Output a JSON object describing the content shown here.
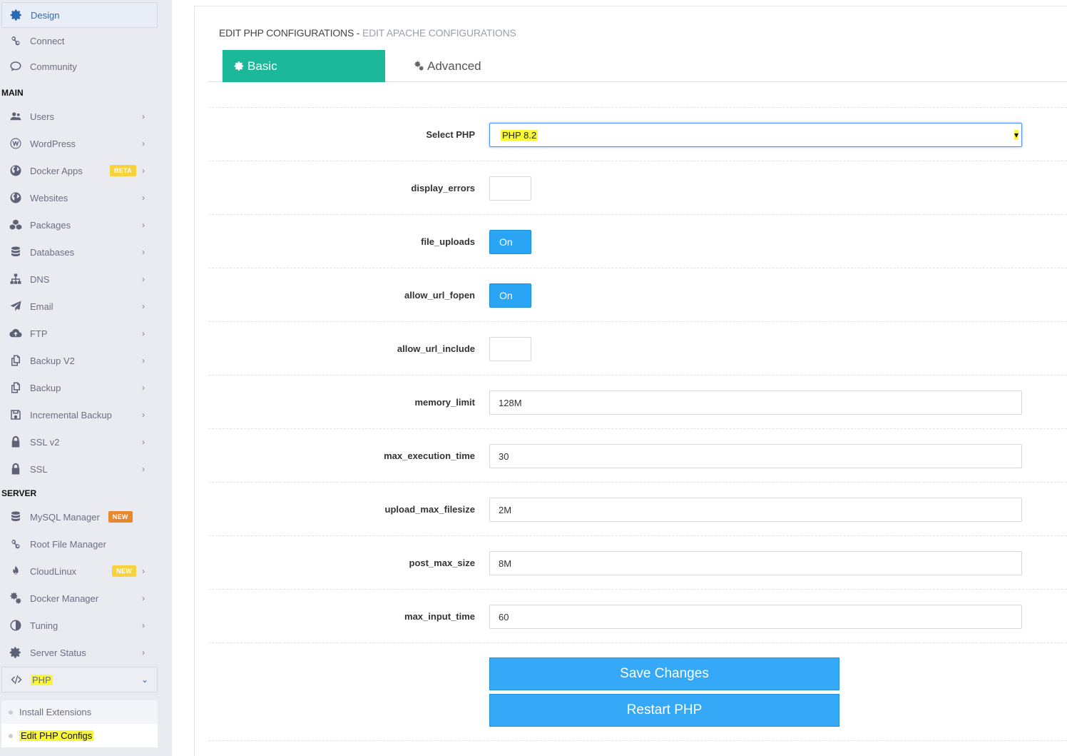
{
  "sidebar": {
    "top_items": [
      {
        "label": "Design",
        "icon": "gear-icon"
      },
      {
        "label": "Connect",
        "icon": "link-icon"
      },
      {
        "label": "Community",
        "icon": "chat-icon"
      }
    ],
    "sections": {
      "main": "MAIN",
      "server": "SERVER"
    },
    "main_items": [
      {
        "label": "Users",
        "icon": "users-icon"
      },
      {
        "label": "WordPress",
        "icon": "wordpress-icon"
      },
      {
        "label": "Docker Apps",
        "icon": "globe-icon",
        "badge": "BETA"
      },
      {
        "label": "Websites",
        "icon": "globe-icon"
      },
      {
        "label": "Packages",
        "icon": "cubes-icon"
      },
      {
        "label": "Databases",
        "icon": "database-icon"
      },
      {
        "label": "DNS",
        "icon": "sitemap-icon"
      },
      {
        "label": "Email",
        "icon": "paper-plane-icon"
      },
      {
        "label": "FTP",
        "icon": "cloud-upload-icon"
      },
      {
        "label": "Backup V2",
        "icon": "copy-icon"
      },
      {
        "label": "Backup",
        "icon": "copy-icon"
      },
      {
        "label": "Incremental Backup",
        "icon": "save-icon"
      },
      {
        "label": "SSL v2",
        "icon": "lock-icon"
      },
      {
        "label": "SSL",
        "icon": "lock-icon"
      }
    ],
    "server_items": [
      {
        "label": "MySQL Manager",
        "icon": "database-icon",
        "badge": "NEW"
      },
      {
        "label": "Root File Manager",
        "icon": "link-icon"
      },
      {
        "label": "CloudLinux",
        "icon": "fire-icon",
        "badge": "NEW"
      },
      {
        "label": "Docker Manager",
        "icon": "gears-icon"
      },
      {
        "label": "Tuning",
        "icon": "half-circle-icon"
      },
      {
        "label": "Server Status",
        "icon": "gear-icon"
      },
      {
        "label": "PHP",
        "icon": "code-icon"
      }
    ],
    "php_submenu": [
      "Install Extensions",
      "Edit PHP Configs"
    ]
  },
  "heading": {
    "title": "EDIT PHP CONFIGURATIONS",
    "separator": " - ",
    "subtitle": "EDIT APACHE CONFIGURATIONS"
  },
  "tabs": {
    "basic": "Basic",
    "advanced": "Advanced"
  },
  "form": {
    "select_php": {
      "label": "Select PHP",
      "value": "PHP 8.2"
    },
    "display_errors": {
      "label": "display_errors",
      "value": ""
    },
    "file_uploads": {
      "label": "file_uploads",
      "value": "On"
    },
    "allow_url_fopen": {
      "label": "allow_url_fopen",
      "value": "On"
    },
    "allow_url_include": {
      "label": "allow_url_include",
      "value": ""
    },
    "memory_limit": {
      "label": "memory_limit",
      "value": "128M"
    },
    "max_execution_time": {
      "label": "max_execution_time",
      "value": "30"
    },
    "upload_max_filesize": {
      "label": "upload_max_filesize",
      "value": "2M"
    },
    "post_max_size": {
      "label": "post_max_size",
      "value": "8M"
    },
    "max_input_time": {
      "label": "max_input_time",
      "value": "60"
    }
  },
  "buttons": {
    "save": "Save Changes",
    "restart": "Restart PHP"
  },
  "colors": {
    "tab_active": "#1bb99a",
    "button": "#35a9f7",
    "toggle_on": "#2aa5f5",
    "highlight": "#faf63a"
  }
}
